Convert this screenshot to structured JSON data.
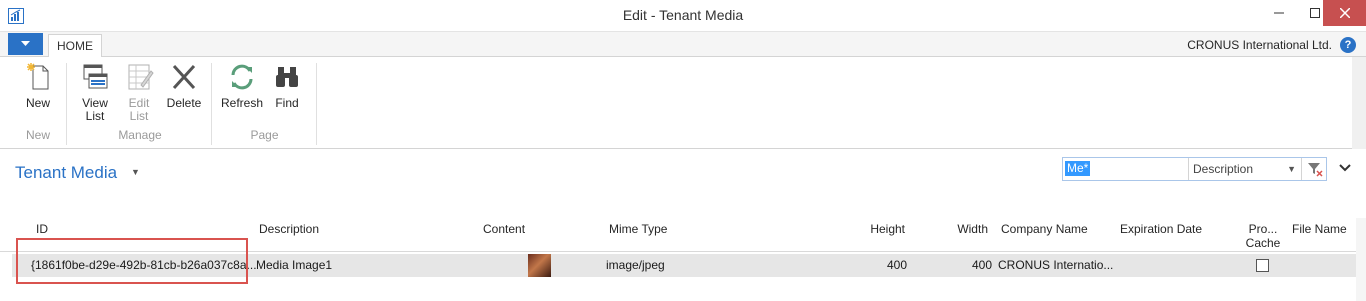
{
  "window": {
    "title": "Edit - Tenant Media"
  },
  "ribbon": {
    "tab_home": "HOME",
    "company_name": "CRONUS International Ltd.",
    "help_glyph": "?",
    "groups": {
      "new": {
        "label": "New",
        "buttons": {
          "new": "New"
        }
      },
      "manage": {
        "label": "Manage",
        "buttons": {
          "view_list": "View List",
          "edit_list": "Edit List",
          "delete": "Delete"
        }
      },
      "page": {
        "label": "Page",
        "buttons": {
          "refresh": "Refresh",
          "find": "Find"
        }
      }
    }
  },
  "page": {
    "title": "Tenant Media",
    "filter": {
      "value": "Me*",
      "field": "Description"
    }
  },
  "table": {
    "headers": {
      "id": "ID",
      "description": "Description",
      "content": "Content",
      "mime_type": "Mime Type",
      "height": "Height",
      "width": "Width",
      "company_name": "Company Name",
      "expiration_date": "Expiration Date",
      "prohibit_cache": "Pro... Cache",
      "file_name": "File Name"
    },
    "rows": [
      {
        "id": "{1861f0be-d29e-492b-81cb-b26a037c8a...",
        "description": "Media Image1",
        "mime_type": "image/jpeg",
        "height": "400",
        "width": "400",
        "company_name": "CRONUS Internatio...",
        "expiration_date": "",
        "prohibit_cache": false,
        "file_name": ""
      }
    ]
  },
  "colors": {
    "accent": "#2a72c6",
    "close_button": "#c75050",
    "highlight": "#d9534f",
    "selected_row": "#e6e6e6"
  },
  "icons": {
    "app": "dynamics-nav-app-icon",
    "new": "new-document-icon",
    "view_list": "view-list-icon",
    "edit_list": "edit-list-icon",
    "delete": "delete-x-icon",
    "refresh": "refresh-icon",
    "find": "binoculars-icon",
    "clear_filter": "clear-filter-icon"
  }
}
